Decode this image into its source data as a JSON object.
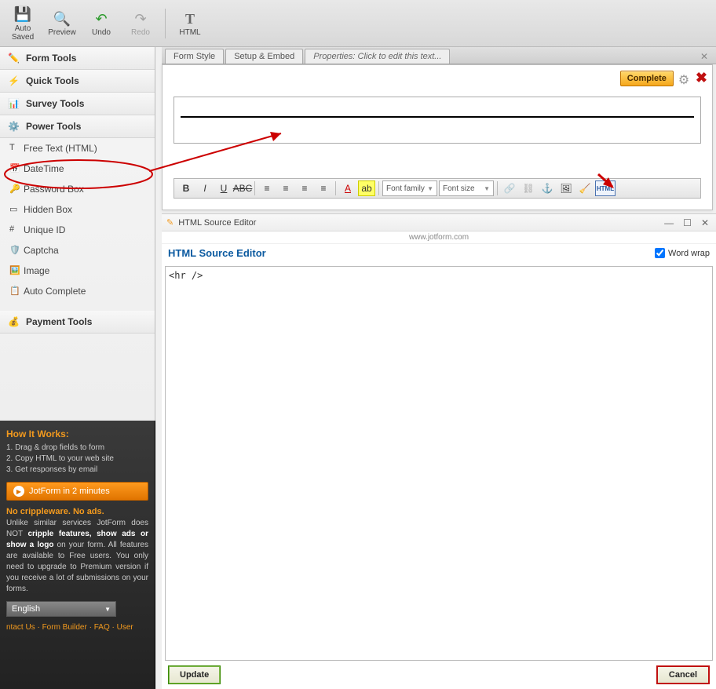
{
  "toolbar": {
    "auto_saved": "Auto\nSaved",
    "preview": "Preview",
    "undo": "Undo",
    "redo": "Redo",
    "html": "HTML"
  },
  "tabs": {
    "form_style": "Form Style",
    "setup_embed": "Setup & Embed",
    "properties": "Properties: Click to edit this text..."
  },
  "sidebar": {
    "form_tools": "Form Tools",
    "quick_tools": "Quick Tools",
    "survey_tools": "Survey Tools",
    "power_tools": "Power Tools",
    "items": {
      "free_text": "Free Text (HTML)",
      "datetime": "DateTime",
      "password_box": "Password Box",
      "hidden_box": "Hidden Box",
      "unique_id": "Unique ID",
      "captcha": "Captcha",
      "image": "Image",
      "auto_complete": "Auto Complete"
    },
    "payment_tools": "Payment Tools"
  },
  "editor": {
    "complete": "Complete",
    "font_family": "Font family",
    "font_size": "Font size"
  },
  "src": {
    "title": "HTML Source Editor",
    "url": "www.jotform.com",
    "header": "HTML Source Editor",
    "word_wrap": "Word wrap",
    "content": "<hr />",
    "update": "Update",
    "cancel": "Cancel"
  },
  "help": {
    "title": "How It Works:",
    "steps": {
      "s1": "Drag & drop fields to form",
      "s2": "Copy HTML to your web site",
      "s3": "Get responses by email"
    },
    "video": "JotForm in 2 minutes",
    "sub": "No crippleware. No ads.",
    "body_pre": "Unlike similar services JotForm does NOT ",
    "body_bold": "cripple features, show ads or show a logo",
    "body_post": " on your form. All features are available to Free users. You only need to upgrade to Premium version if you receive a lot of submissions on your forms.",
    "lang": "English",
    "links": {
      "contact": "ntact Us",
      "builder": "Form Builder",
      "faq": "FAQ",
      "user": "User"
    }
  }
}
